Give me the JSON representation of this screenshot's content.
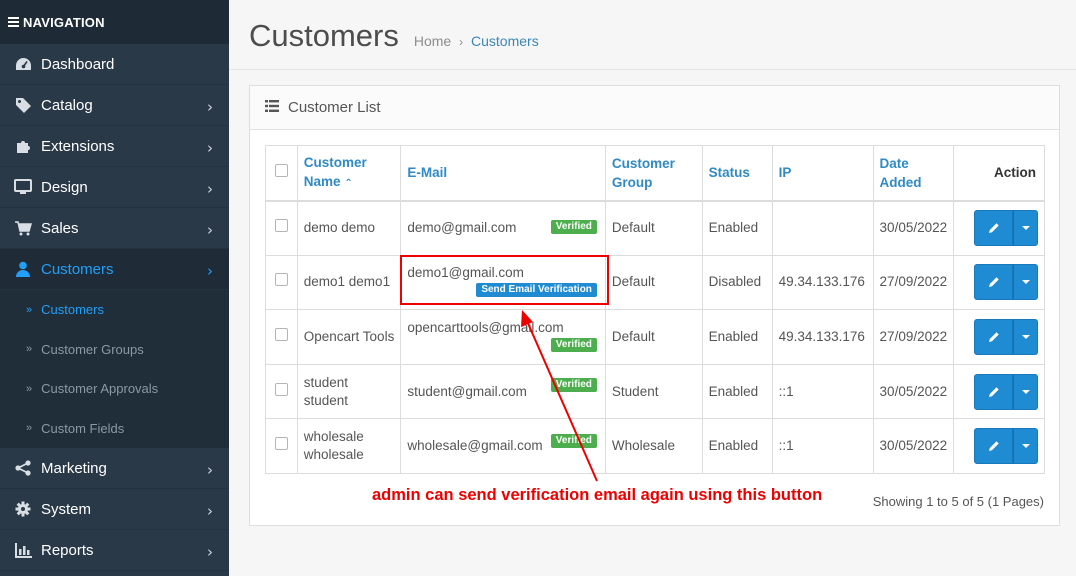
{
  "sidebar": {
    "header": "NAVIGATION",
    "items": [
      {
        "label": "Dashboard",
        "icon": "dashboard-icon"
      },
      {
        "label": "Catalog",
        "icon": "tag-icon"
      },
      {
        "label": "Extensions",
        "icon": "puzzle-icon"
      },
      {
        "label": "Design",
        "icon": "monitor-icon"
      },
      {
        "label": "Sales",
        "icon": "cart-icon"
      },
      {
        "label": "Customers",
        "icon": "user-icon"
      },
      {
        "label": "Marketing",
        "icon": "share-icon"
      },
      {
        "label": "System",
        "icon": "gear-icon"
      },
      {
        "label": "Reports",
        "icon": "bar-chart-icon"
      }
    ],
    "sub_items": [
      {
        "label": "Customers"
      },
      {
        "label": "Customer Groups"
      },
      {
        "label": "Customer Approvals"
      },
      {
        "label": "Custom Fields"
      }
    ]
  },
  "header": {
    "title": "Customers",
    "breadcrumb": [
      "Home",
      "Customers"
    ]
  },
  "panel": {
    "title": "Customer List",
    "columns": [
      "Customer Name",
      "E-Mail",
      "Customer Group",
      "Status",
      "IP",
      "Date Added",
      "Action"
    ],
    "rows": [
      {
        "name": "demo demo",
        "email": "demo@gmail.com",
        "badge": "Verified",
        "group": "Default",
        "status": "Enabled",
        "ip": "",
        "date": "30/05/2022"
      },
      {
        "name": "demo1 demo1",
        "email": "demo1@gmail.com",
        "badge": "Send Email Verification",
        "group": "Default",
        "status": "Disabled",
        "ip": "49.34.133.176",
        "date": "27/09/2022"
      },
      {
        "name": "Opencart Tools",
        "email": "opencarttools@gmail.com",
        "badge": "Verified",
        "group": "Default",
        "status": "Enabled",
        "ip": "49.34.133.176",
        "date": "27/09/2022"
      },
      {
        "name": "student student",
        "email": "student@gmail.com",
        "badge": "Verified",
        "group": "Student",
        "status": "Enabled",
        "ip": "::1",
        "date": "30/05/2022"
      },
      {
        "name": "wholesale wholesale",
        "email": "wholesale@gmail.com",
        "badge": "Verified",
        "group": "Wholesale",
        "status": "Enabled",
        "ip": "::1",
        "date": "30/05/2022"
      }
    ],
    "pagination_text": "Showing 1 to 5 of 5 (1 Pages)"
  },
  "annotation": {
    "text": "admin can send verification email again using this button"
  },
  "colors": {
    "accent": "#229ff6",
    "verified": "#4cae4c",
    "annotation": "#ee0000"
  }
}
